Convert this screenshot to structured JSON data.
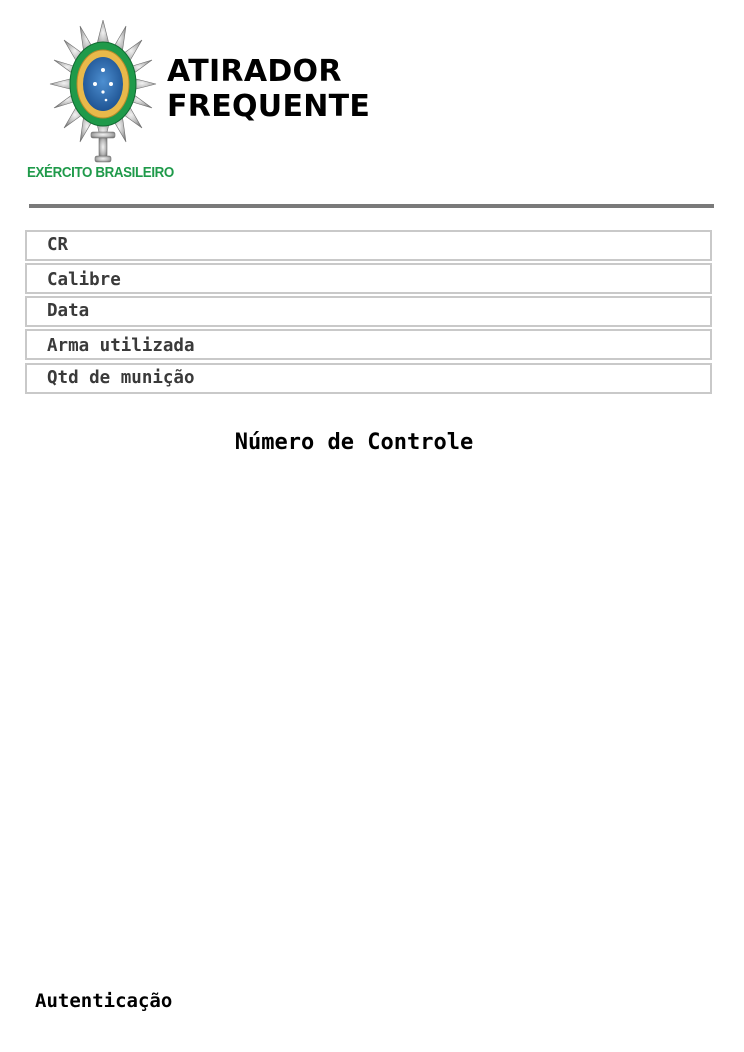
{
  "header": {
    "org_name": "EXÉRCITO BRASILEIRO",
    "title_line1": "ATIRADOR",
    "title_line2": "FREQUENTE",
    "emblem_icon": "army-emblem-icon",
    "brand_color": "#1f9a4a"
  },
  "fields": [
    {
      "label": "CR"
    },
    {
      "label": "Calibre"
    },
    {
      "label": "Data"
    },
    {
      "label": "Arma utilizada"
    },
    {
      "label": "Qtd de munição"
    }
  ],
  "control_label": "Número de Controle",
  "auth_label": "Autenticação"
}
